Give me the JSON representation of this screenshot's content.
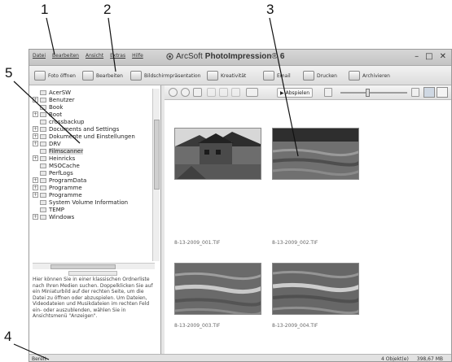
{
  "callouts": [
    "1",
    "2",
    "3",
    "4",
    "5"
  ],
  "titlebar": {
    "menu": [
      "Datei",
      "Bearbeiten",
      "Ansicht",
      "Extras",
      "Hilfe"
    ],
    "brand": "ArcSoft",
    "product": "PhotoImpression",
    "version": "6"
  },
  "toolbar": {
    "open": "Foto öffnen",
    "edit": "Bearbeiten",
    "slideshow": "Bildschirmpräsentation",
    "creative": "Kreativität",
    "email": "Email",
    "print": "Drucken",
    "archive": "Archivieren"
  },
  "tree": [
    {
      "label": "AcerSW",
      "expander": false
    },
    {
      "label": "Benutzer",
      "expander": true
    },
    {
      "label": "Book",
      "expander": false
    },
    {
      "label": "Boot",
      "expander": true
    },
    {
      "label": "crossbackup",
      "expander": false
    },
    {
      "label": "Documents and Settings",
      "expander": true
    },
    {
      "label": "Dokumente und Einstellungen",
      "expander": true
    },
    {
      "label": "DRV",
      "expander": true
    },
    {
      "label": "Filmscanner",
      "expander": false,
      "selected": true
    },
    {
      "label": "Heinricks",
      "expander": true
    },
    {
      "label": "MSOCache",
      "expander": false
    },
    {
      "label": "PerfLogs",
      "expander": false
    },
    {
      "label": "ProgramData",
      "expander": true
    },
    {
      "label": "Programme",
      "expander": true
    },
    {
      "label": "Programme",
      "expander": true
    },
    {
      "label": "System Volume Information",
      "expander": false
    },
    {
      "label": "TEMP",
      "expander": false
    },
    {
      "label": "Windows",
      "expander": true
    }
  ],
  "help_text": "Hier können Sie in einer klassischen Ordnerliste nach Ihren Medien suchen. Doppelklicken Sie auf ein Miniaturbild auf der rechten Seite, um die Datei zu öffnen oder abzuspielen. Um Dateien, Videodateien und Musikdateien im rechten Feld ein- oder auszublenden, wählen Sie in Ansichtsmenü \"Anzeigen\".",
  "viewer": {
    "play_label": "Abspielen"
  },
  "thumbnails": [
    {
      "caption": "8-13-2009_001.TIF"
    },
    {
      "caption": "8-13-2009_002.TIF"
    },
    {
      "caption": "8-13-2009_003.TIF"
    },
    {
      "caption": "8-13-2009_004.TIF"
    }
  ],
  "statusbar": {
    "left": "Bereit",
    "count": "4 Objekt(e)",
    "size": "398,67 MB"
  }
}
